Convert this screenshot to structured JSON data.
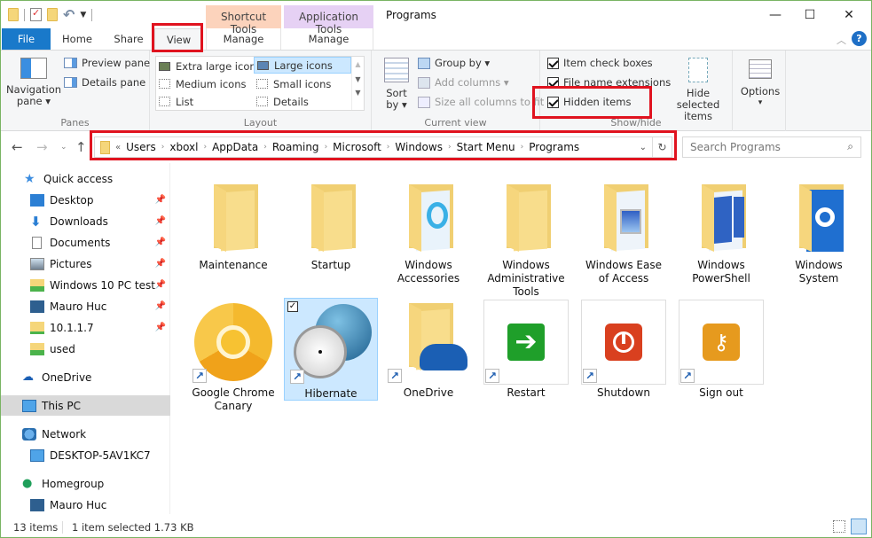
{
  "window": {
    "title": "Programs",
    "controls": {
      "minimize": "—",
      "maximize": "☐",
      "close": "✕"
    }
  },
  "context_tabs": [
    {
      "group": "Shortcut Tools",
      "tab": "Manage",
      "color": "#fcd3bc"
    },
    {
      "group": "Application Tools",
      "tab": "Manage",
      "color": "#e6d1f4"
    }
  ],
  "ribbon_tabs": [
    "File",
    "Home",
    "Share",
    "View"
  ],
  "active_tab": "View",
  "ribbon": {
    "panes": {
      "label": "Panes",
      "navigation_pane": "Navigation pane",
      "nav_line1": "Navigation",
      "nav_line2": "pane ▾",
      "preview_pane": "Preview pane",
      "details_pane": "Details pane"
    },
    "layout": {
      "label": "Layout",
      "items": [
        "Extra large icons",
        "Large icons",
        "Medium icons",
        "Small icons",
        "List",
        "Details"
      ],
      "selected": "Large icons"
    },
    "current_view": {
      "label": "Current view",
      "sort_line1": "Sort",
      "sort_line2": "by ▾",
      "group_by": "Group by ▾",
      "add_columns": "Add columns ▾",
      "size_columns": "Size all columns to fit"
    },
    "show_hide": {
      "label": "Show/hide",
      "item_check_boxes": {
        "label": "Item check boxes",
        "checked": true
      },
      "file_name_extensions": {
        "label": "File name extensions",
        "checked": true
      },
      "hidden_items": {
        "label": "Hidden items",
        "checked": true
      },
      "hide_selected_line1": "Hide selected",
      "hide_selected_line2": "items"
    },
    "options": {
      "label": "Options",
      "arrow": "▾"
    }
  },
  "address": {
    "overflow": "«",
    "path": [
      "Users",
      "xboxl",
      "AppData",
      "Roaming",
      "Microsoft",
      "Windows",
      "Start Menu",
      "Programs"
    ],
    "search_placeholder": "Search Programs"
  },
  "nav_pane": {
    "quick_access": "Quick access",
    "quick_items": [
      {
        "label": "Desktop",
        "pinned": true
      },
      {
        "label": "Downloads",
        "pinned": true
      },
      {
        "label": "Documents",
        "pinned": true
      },
      {
        "label": "Pictures",
        "pinned": true
      },
      {
        "label": "Windows 10 PC test",
        "pinned": true
      },
      {
        "label": "Mauro Huc",
        "pinned": true
      },
      {
        "label": "10.1.1.7",
        "pinned": true
      },
      {
        "label": "used",
        "pinned": false
      }
    ],
    "onedrive": "OneDrive",
    "this_pc": "This PC",
    "network": "Network",
    "network_items": [
      "DESKTOP-5AV1KC7"
    ],
    "homegroup": "Homegroup",
    "homegroup_items": [
      "Mauro Huc"
    ]
  },
  "items": [
    {
      "name": "Maintenance",
      "type": "folder"
    },
    {
      "name": "Startup",
      "type": "folder"
    },
    {
      "name": "Windows Accessories",
      "type": "folder"
    },
    {
      "name": "Windows Administrative Tools",
      "type": "folder"
    },
    {
      "name": "Windows Ease of Access",
      "type": "folder"
    },
    {
      "name": "Windows PowerShell",
      "type": "folder"
    },
    {
      "name": "Windows System",
      "type": "folder"
    },
    {
      "name": "Google Chrome Canary",
      "type": "shortcut"
    },
    {
      "name": "Hibernate",
      "type": "shortcut",
      "selected": true
    },
    {
      "name": "OneDrive",
      "type": "shortcut"
    },
    {
      "name": "Restart",
      "type": "shortcut"
    },
    {
      "name": "Shutdown",
      "type": "shortcut"
    },
    {
      "name": "Sign out",
      "type": "shortcut"
    }
  ],
  "status": {
    "count": "13 items",
    "selection": "1 item selected  1.73 KB"
  }
}
